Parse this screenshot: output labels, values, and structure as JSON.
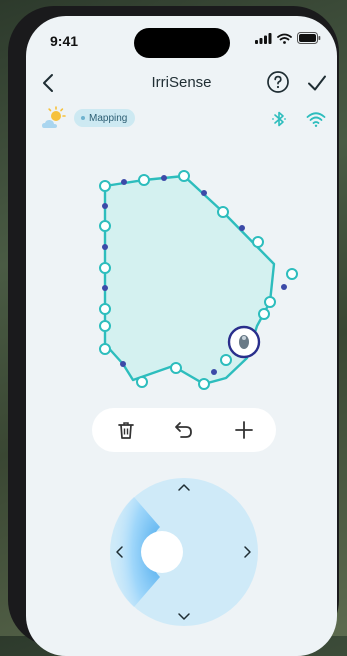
{
  "status_bar": {
    "time": "9:41"
  },
  "header": {
    "title": "IrriSense"
  },
  "mode_badge": {
    "label": "Mapping"
  },
  "colors": {
    "accent": "#2dbdbd",
    "node_fill": "#ffffff",
    "marker_dot": "#3c4aa8",
    "area_fill": "#d4f1f0",
    "joystick": "#cfeaf8"
  },
  "icons": {
    "back": "chevron-left-icon",
    "help": "question-circle-icon",
    "confirm": "checkmark-icon",
    "weather": "partly-sunny-icon",
    "bluetooth": "bluetooth-icon",
    "wifi": "wifi-icon",
    "delete": "trash-icon",
    "undo": "undo-icon",
    "add": "plus-icon"
  }
}
